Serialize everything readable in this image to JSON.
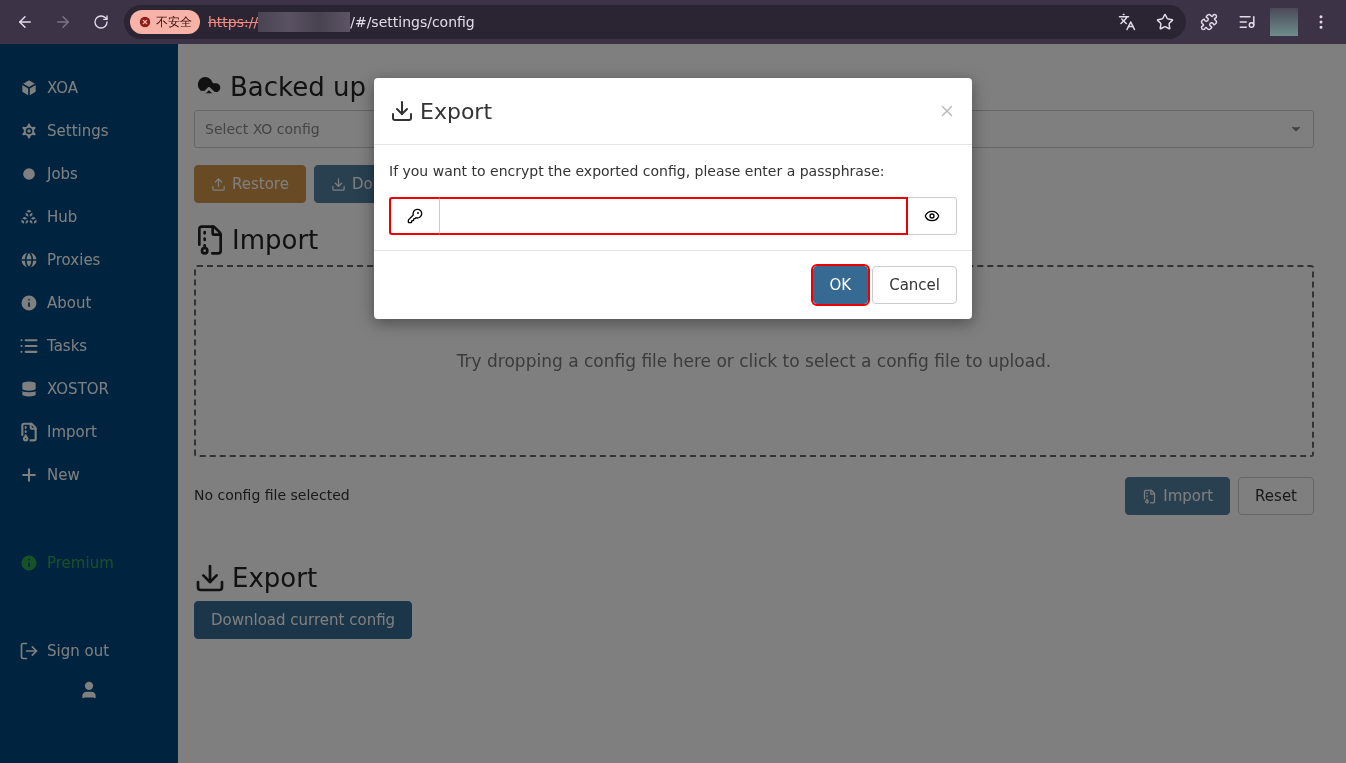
{
  "browser": {
    "security_badge": "不安全",
    "url_scheme": "https://",
    "url_path": "/#/settings/config"
  },
  "sidebar": {
    "items": [
      {
        "label": "XOA"
      },
      {
        "label": "Settings"
      },
      {
        "label": "Jobs"
      },
      {
        "label": "Hub"
      },
      {
        "label": "Proxies"
      },
      {
        "label": "About"
      },
      {
        "label": "Tasks"
      },
      {
        "label": "XOSTOR"
      },
      {
        "label": "Import"
      },
      {
        "label": "New"
      }
    ],
    "premium": "Premium",
    "sign_out": "Sign out"
  },
  "backup_section": {
    "title": "Backed up",
    "select": {
      "placeholder": "Select XO config"
    },
    "buttons": [
      {
        "label": "Restore",
        "kind": "warning"
      },
      {
        "label": "Do",
        "kind": "primary"
      }
    ]
  },
  "import_section": {
    "title": "Import",
    "dropzone": "Try dropping a config file here or click to select a config file to upload.",
    "status": "No config file selected",
    "buttons": [
      {
        "label": "Import",
        "kind": "primary"
      },
      {
        "label": "Reset",
        "kind": "default"
      }
    ]
  },
  "export_section": {
    "title": "Export",
    "button": "Download current config"
  },
  "modal": {
    "title": "Export",
    "message": "If you want to encrypt the exported config, please enter a passphrase:",
    "passphrase_visible": false,
    "buttons": [
      {
        "label": "OK",
        "kind": "primary",
        "focused": true
      },
      {
        "label": "Cancel",
        "kind": "default",
        "focused": false
      }
    ]
  }
}
